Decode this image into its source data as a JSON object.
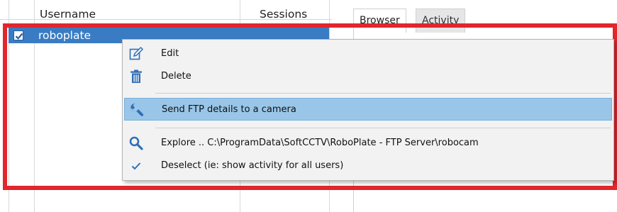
{
  "grid": {
    "columns": [
      "Username",
      "Sessions"
    ],
    "rows": [
      {
        "username": "roboplate",
        "checked": true,
        "selected": true
      }
    ]
  },
  "tabs": [
    {
      "label": "Browser",
      "active": true
    },
    {
      "label": "Activity",
      "active": false
    }
  ],
  "context_menu": {
    "items": [
      {
        "icon": "edit-icon",
        "label": "Edit",
        "highlighted": false
      },
      {
        "icon": "trash-icon",
        "label": "Delete",
        "highlighted": false
      },
      {
        "icon": "wrench-icon",
        "label": "Send FTP details to a camera",
        "highlighted": true
      },
      {
        "icon": "search-icon",
        "label": "Explore .. C:\\ProgramData\\SoftCCTV\\RoboPlate - FTP Server\\robocam",
        "highlighted": false
      },
      {
        "icon": "checkmark-icon",
        "label": "Deselect (ie: show activity for all users)",
        "highlighted": false
      }
    ]
  },
  "colors": {
    "selection_row": "#3a7cc3",
    "menu_highlight": "#99c6e8",
    "annotation_border": "#e1262c",
    "icon_blue": "#2f6fb6"
  }
}
